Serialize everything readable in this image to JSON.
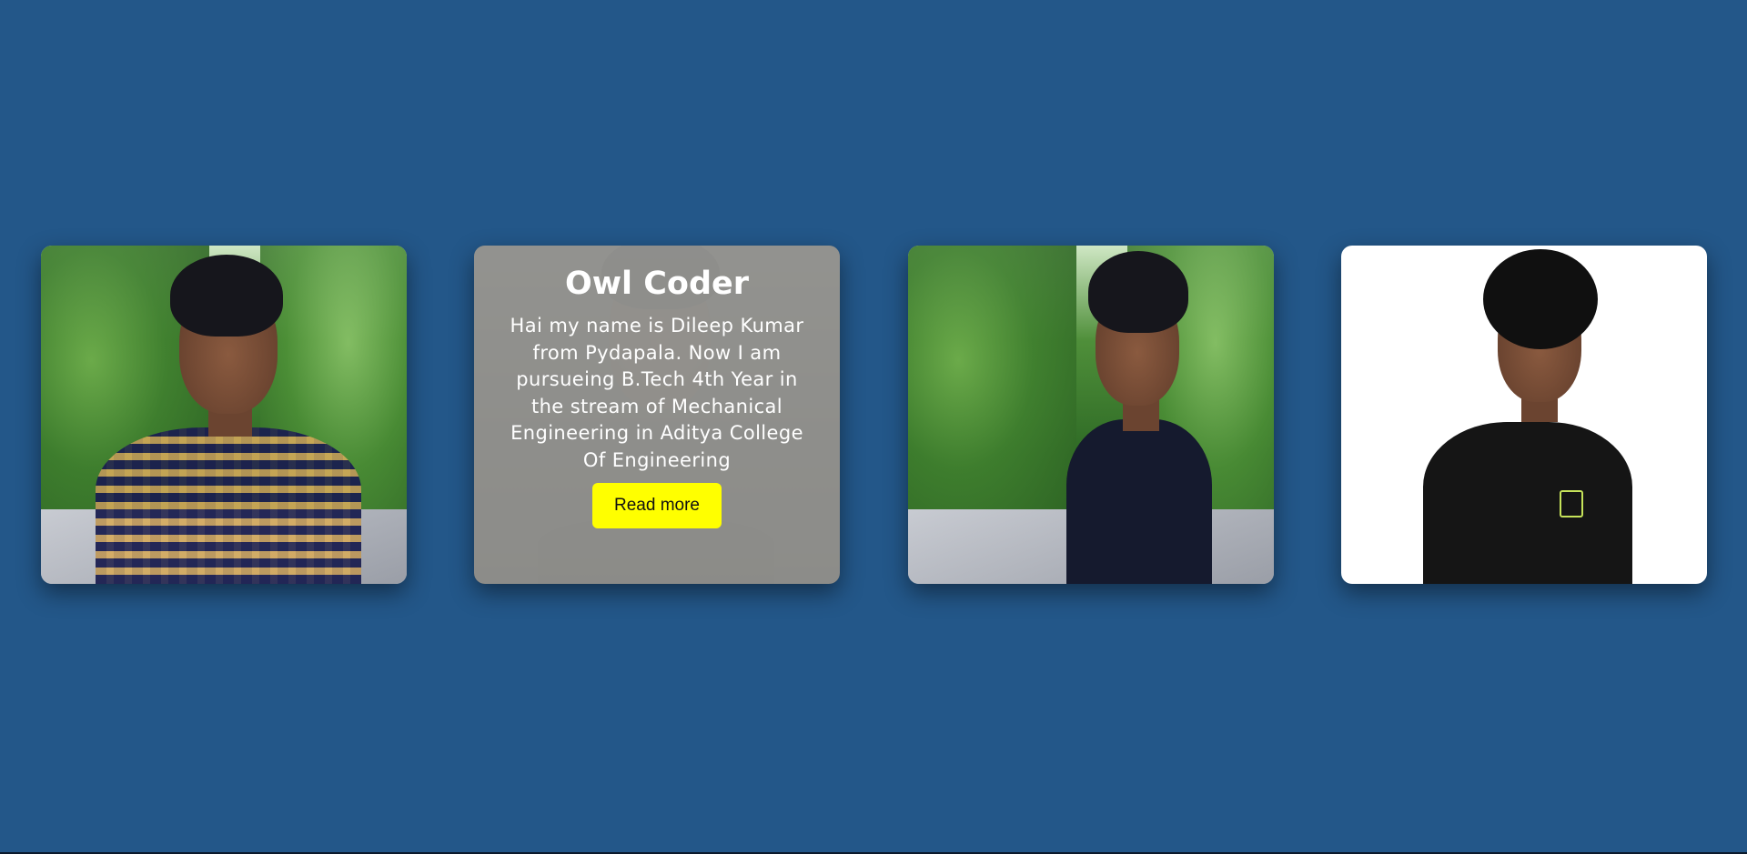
{
  "page": {
    "background_color": "#235789"
  },
  "cards": [
    {
      "scene": "outdoor-road",
      "person": "man-in-checked-shirt"
    },
    {
      "scene": "dark-portrait",
      "person": "man-in-black-polo",
      "overlay": {
        "title": "Owl Coder",
        "description": "Hai my name is Dileep Kumar from Pydapala. Now I am pursueing B.Tech 4th Year in the stream of Mechanical Engineering in Aditya College Of Engineering",
        "button_label": "Read more",
        "button_color": "#ffff00"
      }
    },
    {
      "scene": "outdoor-road",
      "person": "man-in-navy-tshirt"
    },
    {
      "scene": "white-studio",
      "person": "man-in-black-polo-arms-crossed"
    }
  ]
}
